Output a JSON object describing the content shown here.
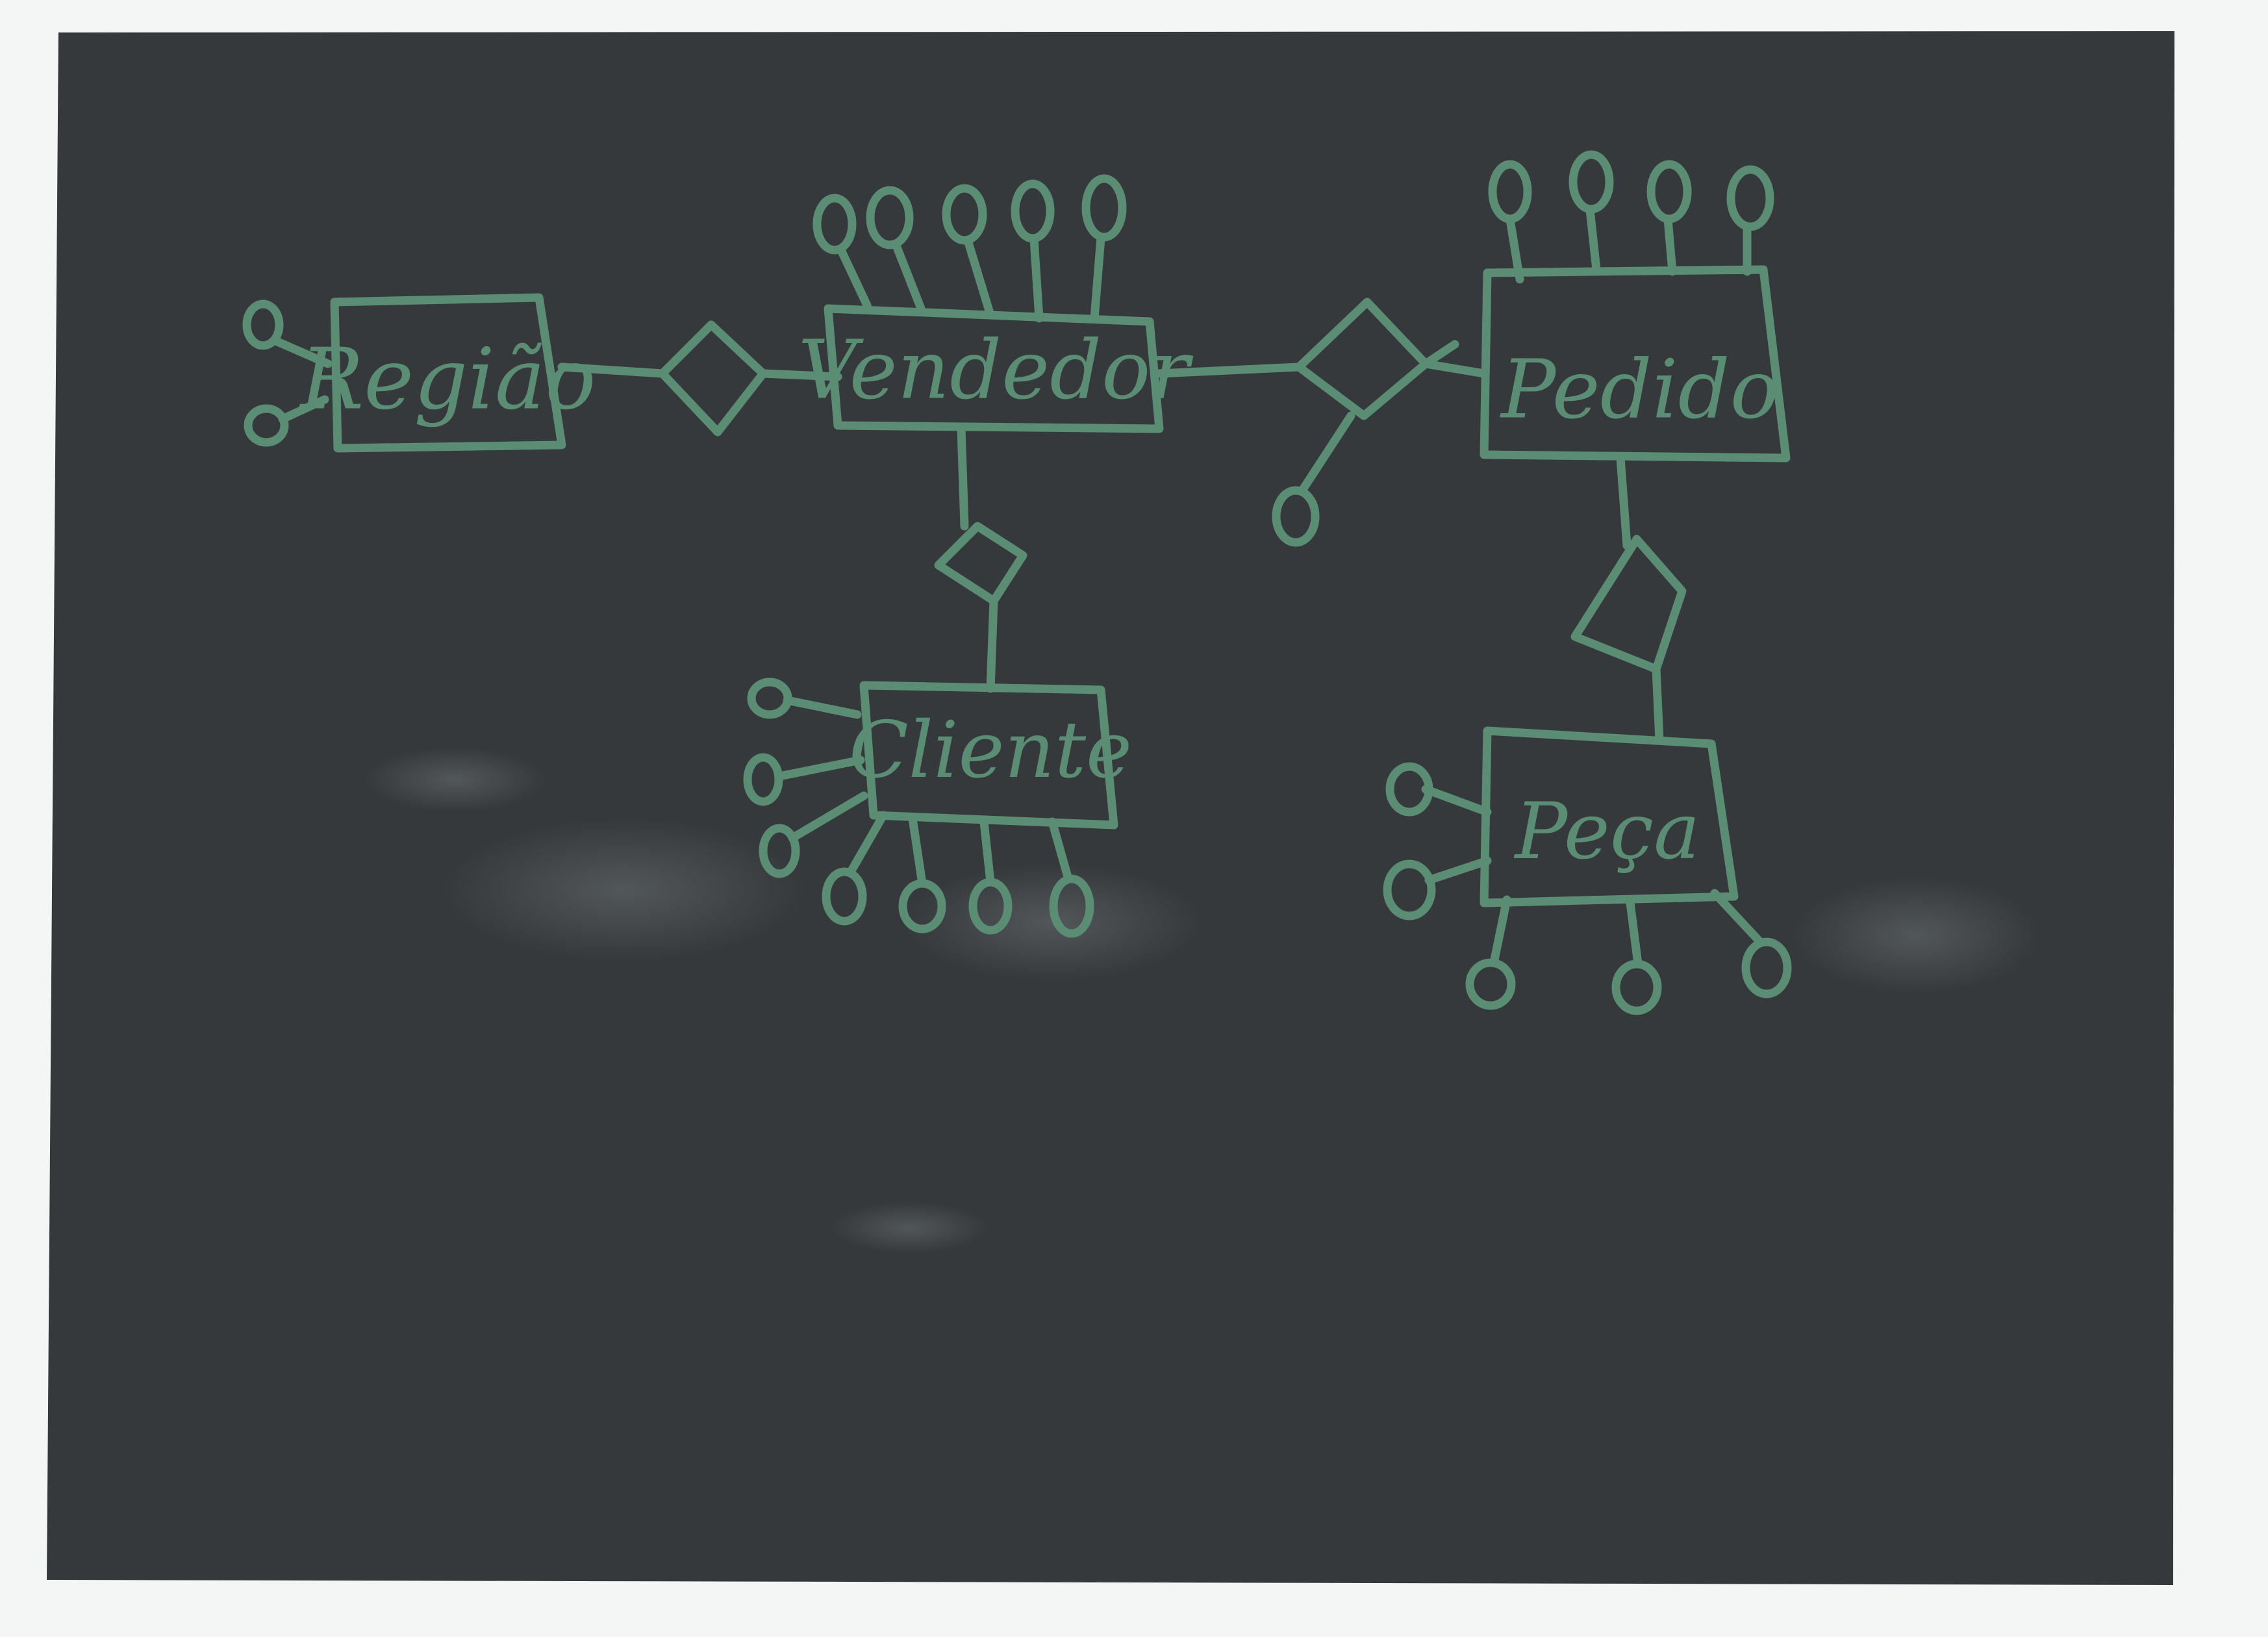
{
  "board": {
    "surface_color": "#35393b",
    "chalk_color": "#5b8c74",
    "paper_color": "#f4f5f5"
  },
  "entities": {
    "regiao": {
      "label": "Região"
    },
    "vendedor": {
      "label": "Vendedor"
    },
    "pedido": {
      "label": "Pedido"
    },
    "cliente": {
      "label": "Cliente"
    },
    "peca": {
      "label": "Peça"
    }
  },
  "relationships": {
    "regiao_vendedor": {
      "label": ""
    },
    "vendedor_pedido": {
      "label": ""
    },
    "vendedor_cliente": {
      "label": ""
    },
    "pedido_peca": {
      "label": ""
    }
  }
}
